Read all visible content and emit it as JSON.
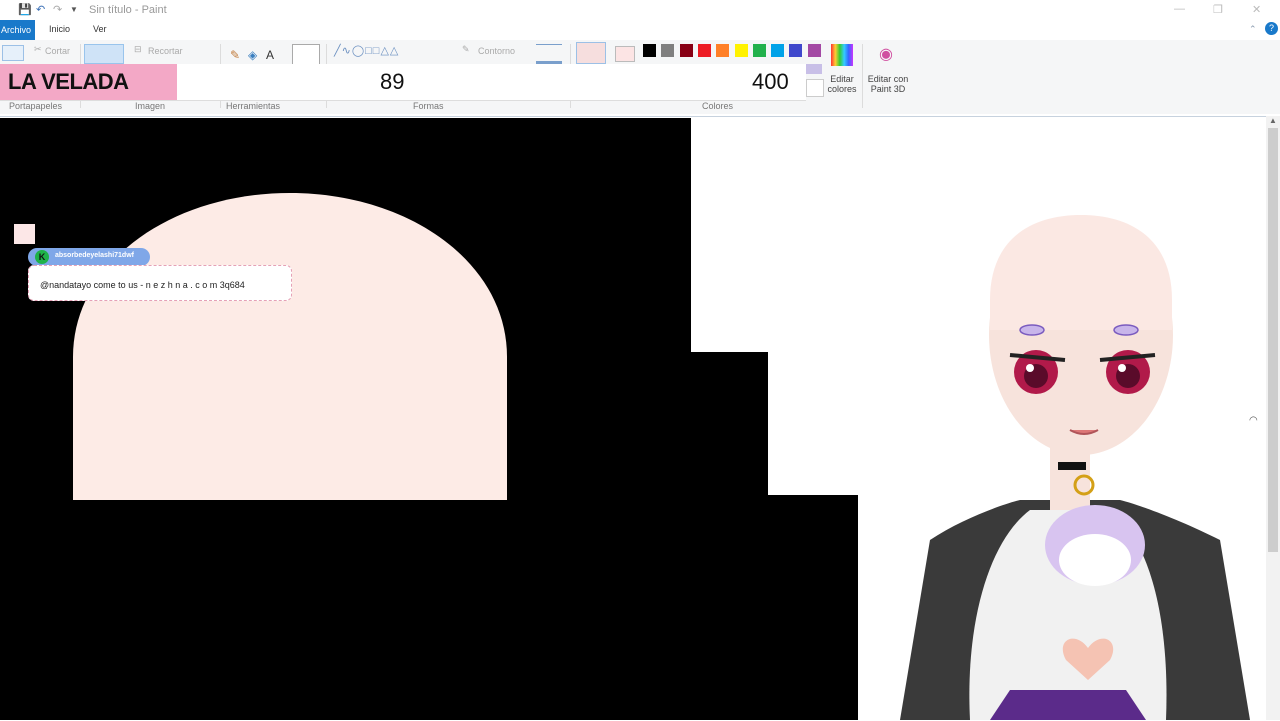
{
  "window": {
    "title": "Sin título - Paint",
    "min": "—",
    "max": "❐",
    "close": "✕"
  },
  "menu": {
    "file": "Archivo",
    "home": "Inicio",
    "view": "Ver"
  },
  "ribbon": {
    "cut": "Cortar",
    "crop": "Recortar",
    "outline": "Contorno",
    "edit_colors": "Editar colores",
    "edit_paint3d": "Editar con Paint 3D",
    "groups": [
      "Portapapeles",
      "Imagen",
      "Herramientas",
      "Formas",
      "Colores"
    ],
    "palette": [
      "#000000",
      "#7f7f7f",
      "#880015",
      "#ed1c24",
      "#ff7f27",
      "#fff200",
      "#22b14c",
      "#00a2e8",
      "#3f48cc",
      "#a349a4"
    ]
  },
  "overlay": {
    "title": "LA VELADA",
    "value1": "89",
    "value2": "400"
  },
  "chat": {
    "username": "absorbedeyelashi71dwf",
    "message": "@nandatayo come to us - n e z h n a . c o m 3q684"
  }
}
